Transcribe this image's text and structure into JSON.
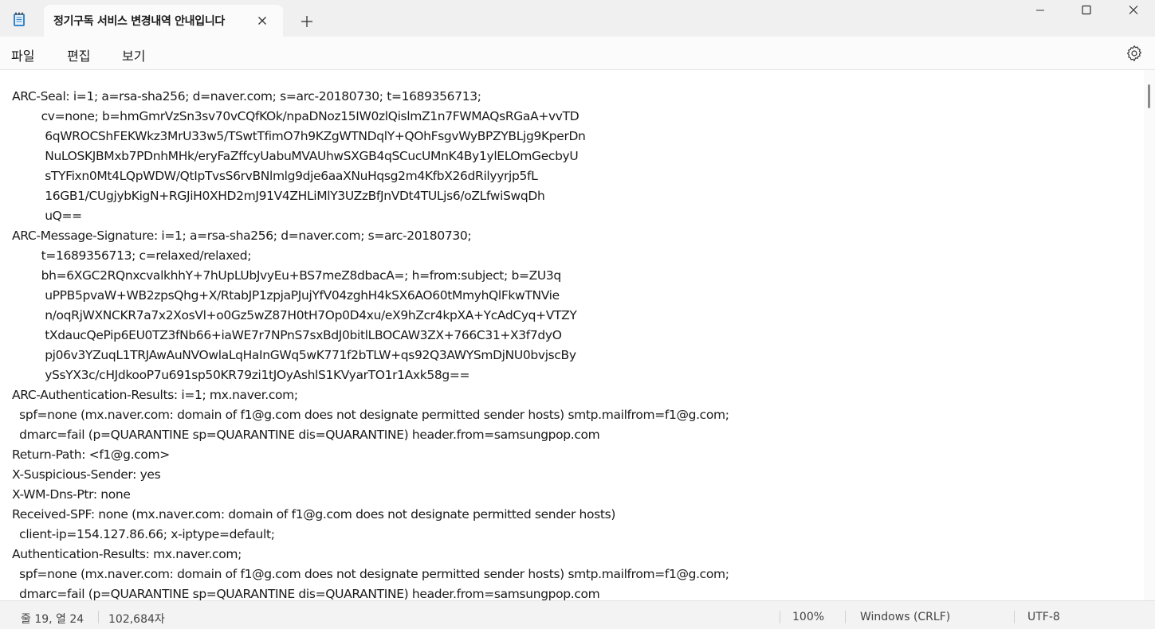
{
  "window": {
    "tab_title": "정기구독 서비스 변경내역 안내입니다",
    "icons": {
      "app": "notepad-icon",
      "close_tab": "close-icon",
      "new_tab": "plus-icon",
      "minimize": "minimize-icon",
      "maximize": "maximize-icon",
      "close": "close-icon"
    }
  },
  "menu": {
    "file": "파일",
    "edit": "편집",
    "view": "보기",
    "settings_icon": "gear-icon"
  },
  "editor": {
    "lines": [
      "ARC-Seal: i=1; a=rsa-sha256; d=naver.com; s=arc-20180730; t=1689356713;",
      "        cv=none; b=hmGmrVzSn3sv70vCQfKOk/npaDNoz15IW0zlQislmZ1n7FWMAQsRGaA+vvTD",
      "         6qWROCShFEKWkz3MrU33w5/TSwtTfimO7h9KZgWTNDqlY+QOhFsgvWyBPZYBLjg9KperDn",
      "         NuLOSKJBMxb7PDnhMHk/eryFaZffcyUabuMVAUhwSXGB4qSCucUMnK4By1ylELOmGecbyU",
      "         sTYFixn0Mt4LQpWDW/QtIpTvsS6rvBNlmlg9dje6aaXNuHqsg2m4KfbX26dRilyyrjp5fL",
      "         16GB1/CUgjybKigN+RGJiH0XHD2mJ91V4ZHLiMlY3UZzBfJnVDt4TULjs6/oZLfwiSwqDh",
      "         uQ==",
      "ARC-Message-Signature: i=1; a=rsa-sha256; d=naver.com; s=arc-20180730;",
      "        t=1689356713; c=relaxed/relaxed;",
      "        bh=6XGC2RQnxcvalkhhY+7hUpLUbJvyEu+BS7meZ8dbacA=; h=from:subject; b=ZU3q",
      "         uPPB5pvaW+WB2zpsQhg+X/RtabJP1zpjaPJujYfV04zghH4kSX6AO60tMmyhQlFkwTNVie",
      "         n/oqRjWXNCKR7a7x2XosVl+o0Gz5wZ87H0tH7Op0D4xu/eX9hZcr4kpXA+YcAdCyq+VTZY",
      "         tXdaucQePip6EU0TZ3fNb66+iaWE7r7NPnS7sxBdJ0bitlLBOCAW3ZX+766C31+X3f7dyO",
      "         pj06v3YZuqL1TRJAwAuNVOwlaLqHaInGWq5wK771f2bTLW+qs92Q3AWYSmDjNU0bvjscBy",
      "         ySsYX3c/cHJdkooP7u691sp50KR79zi1tJOyAshlS1KVyarTO1r1Axk58g==",
      "ARC-Authentication-Results: i=1; mx.naver.com;",
      "  spf=none (mx.naver.com: domain of f1@g.com does not designate permitted sender hosts) smtp.mailfrom=f1@g.com;",
      "  dmarc=fail (p=QUARANTINE sp=QUARANTINE dis=QUARANTINE) header.from=samsungpop.com",
      "Return-Path: <f1@g.com>",
      "X-Suspicious-Sender: yes",
      "X-WM-Dns-Ptr: none",
      "Received-SPF: none (mx.naver.com: domain of f1@g.com does not designate permitted sender hosts)",
      "  client-ip=154.127.86.66; x-iptype=default;",
      "Authentication-Results: mx.naver.com;",
      "  spf=none (mx.naver.com: domain of f1@g.com does not designate permitted sender hosts) smtp.mailfrom=f1@g.com;",
      "  dmarc=fail (p=QUARANTINE sp=QUARANTINE dis=QUARANTINE) header.from=samsungpop.com"
    ]
  },
  "status": {
    "position": "줄 19, 열 24",
    "char_count": "102,684자",
    "zoom": "100%",
    "line_ending": "Windows (CRLF)",
    "encoding": "UTF-8"
  }
}
